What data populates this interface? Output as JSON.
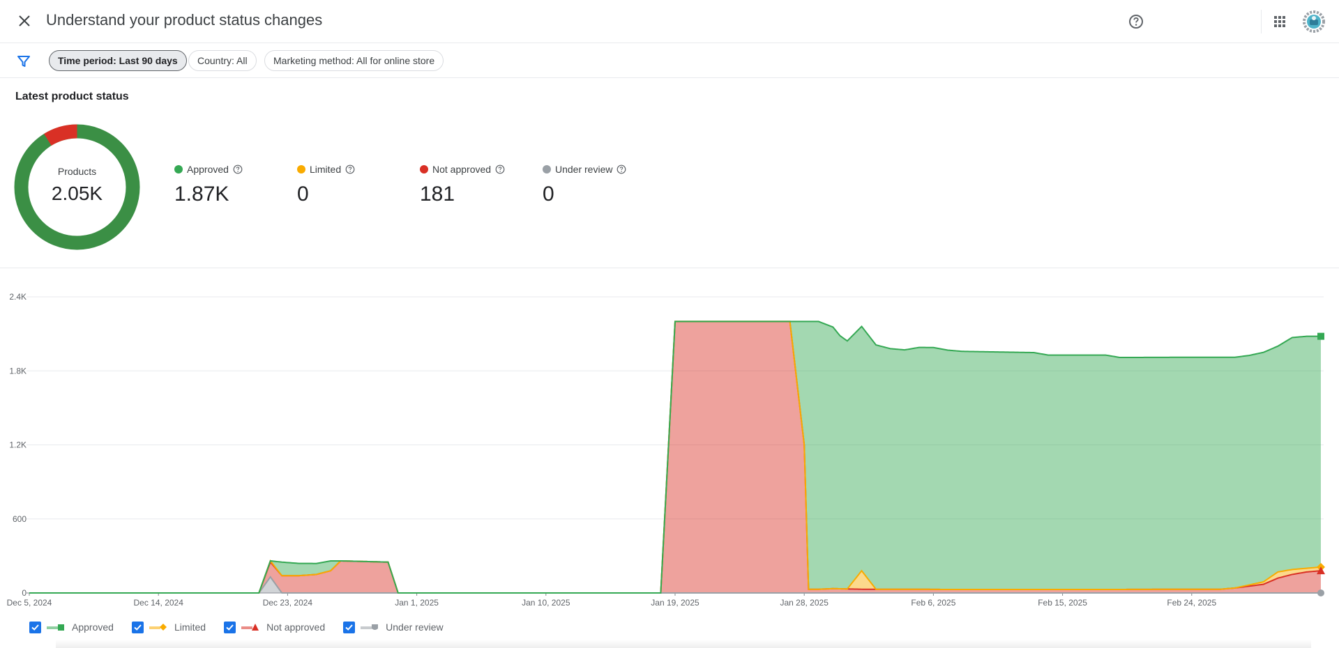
{
  "header": {
    "title": "Understand your product status changes",
    "close_icon": "close-icon",
    "help_icon": "help-circle-icon",
    "apps_icon": "apps-grid-icon"
  },
  "filters": {
    "icon": "filter-icon",
    "chips": [
      {
        "label": "Time period: Last 90 days",
        "active": true
      },
      {
        "label": "Country: All",
        "active": false
      },
      {
        "label": "Marketing method: All for online store",
        "active": false
      }
    ]
  },
  "summary": {
    "title": "Latest product status",
    "donut_label": "Products",
    "donut_value": "2.05K",
    "stats": [
      {
        "label": "Approved",
        "value": "1.87K",
        "color": "#34a853"
      },
      {
        "label": "Limited",
        "value": "0",
        "color": "#f9ab00"
      },
      {
        "label": "Not approved",
        "value": "181",
        "color": "#d93025"
      },
      {
        "label": "Under review",
        "value": "0",
        "color": "#9aa0a6"
      }
    ]
  },
  "legend": [
    {
      "label": "Approved",
      "color": "#34a853"
    },
    {
      "label": "Limited",
      "color": "#f9ab00"
    },
    {
      "label": "Not approved",
      "color": "#d93025"
    },
    {
      "label": "Under review",
      "color": "#9aa0a6"
    }
  ],
  "chart_data": {
    "type": "area",
    "y_ticks": [
      "0",
      "600",
      "1.2K",
      "1.8K",
      "2.4K"
    ],
    "ylim": [
      0,
      2400
    ],
    "x_ticks": [
      {
        "label": "Dec 5, 2024",
        "day": 0
      },
      {
        "label": "Dec 14, 2024",
        "day": 9
      },
      {
        "label": "Dec 23, 2024",
        "day": 18
      },
      {
        "label": "Jan 1, 2025",
        "day": 27
      },
      {
        "label": "Jan 10, 2025",
        "day": 36
      },
      {
        "label": "Jan 19, 2025",
        "day": 45
      },
      {
        "label": "Jan 28, 2025",
        "day": 54
      },
      {
        "label": "Feb 6, 2025",
        "day": 63
      },
      {
        "label": "Feb 15, 2025",
        "day": 72
      },
      {
        "label": "Feb 24, 2025",
        "day": 81
      }
    ],
    "grid": true,
    "stacked": true,
    "series": [
      {
        "name": "Under review",
        "color": "#9aa0a6",
        "points": [
          [
            0,
            0
          ],
          [
            16,
            0
          ],
          [
            16.8,
            130
          ],
          [
            17.6,
            0
          ],
          [
            90,
            0
          ]
        ]
      },
      {
        "name": "Not approved",
        "color": "#d93025",
        "points": [
          [
            0,
            0
          ],
          [
            16,
            0
          ],
          [
            16.8,
            120
          ],
          [
            17.6,
            140
          ],
          [
            18.8,
            140
          ],
          [
            20,
            150
          ],
          [
            21,
            180
          ],
          [
            21.7,
            260
          ],
          [
            25,
            250
          ],
          [
            25.7,
            0
          ],
          [
            44,
            0
          ],
          [
            45,
            2200
          ],
          [
            53,
            2200
          ],
          [
            54,
            1200
          ],
          [
            54.3,
            30
          ],
          [
            55,
            30
          ],
          [
            56,
            35
          ],
          [
            58,
            30
          ],
          [
            60,
            30
          ],
          [
            62,
            30
          ],
          [
            64,
            28
          ],
          [
            70,
            28
          ],
          [
            75,
            28
          ],
          [
            80,
            30
          ],
          [
            83,
            30
          ],
          [
            84,
            40
          ],
          [
            86,
            70
          ],
          [
            87,
            120
          ],
          [
            88,
            150
          ],
          [
            89,
            170
          ],
          [
            90,
            180
          ]
        ]
      },
      {
        "name": "Limited",
        "color": "#f9ab00",
        "points": [
          [
            0,
            0
          ],
          [
            16,
            0
          ],
          [
            16.8,
            10
          ],
          [
            17.6,
            0
          ],
          [
            25.7,
            0
          ],
          [
            44,
            0
          ],
          [
            53,
            0
          ],
          [
            54,
            0
          ],
          [
            57,
            0
          ],
          [
            58,
            150
          ],
          [
            59,
            0
          ],
          [
            84,
            0
          ],
          [
            86,
            20
          ],
          [
            87,
            50
          ],
          [
            88,
            40
          ],
          [
            89,
            30
          ],
          [
            90,
            30
          ]
        ]
      },
      {
        "name": "Approved",
        "color": "#34a853",
        "points": [
          [
            0,
            0
          ],
          [
            16,
            0
          ],
          [
            16.8,
            0
          ],
          [
            17.6,
            110
          ],
          [
            21,
            80
          ],
          [
            21.7,
            0
          ],
          [
            25,
            0
          ],
          [
            25.7,
            0
          ],
          [
            44,
            0
          ],
          [
            45,
            0
          ],
          [
            53,
            0
          ],
          [
            54,
            1000
          ],
          [
            54.3,
            2170
          ],
          [
            55,
            2170
          ],
          [
            56,
            2120
          ],
          [
            56.5,
            2050
          ],
          [
            57,
            2010
          ],
          [
            58,
            1980
          ],
          [
            59,
            1980
          ],
          [
            60,
            1950
          ],
          [
            61,
            1940
          ],
          [
            62,
            1960
          ],
          [
            63,
            1960
          ],
          [
            64,
            1940
          ],
          [
            65,
            1930
          ],
          [
            70,
            1920
          ],
          [
            71,
            1900
          ],
          [
            75,
            1900
          ],
          [
            76,
            1880
          ],
          [
            80,
            1880
          ],
          [
            83,
            1880
          ],
          [
            84,
            1870
          ],
          [
            85,
            1860
          ],
          [
            86,
            1860
          ],
          [
            87,
            1830
          ],
          [
            88,
            1880
          ],
          [
            89,
            1880
          ],
          [
            90,
            1870
          ]
        ]
      }
    ]
  }
}
